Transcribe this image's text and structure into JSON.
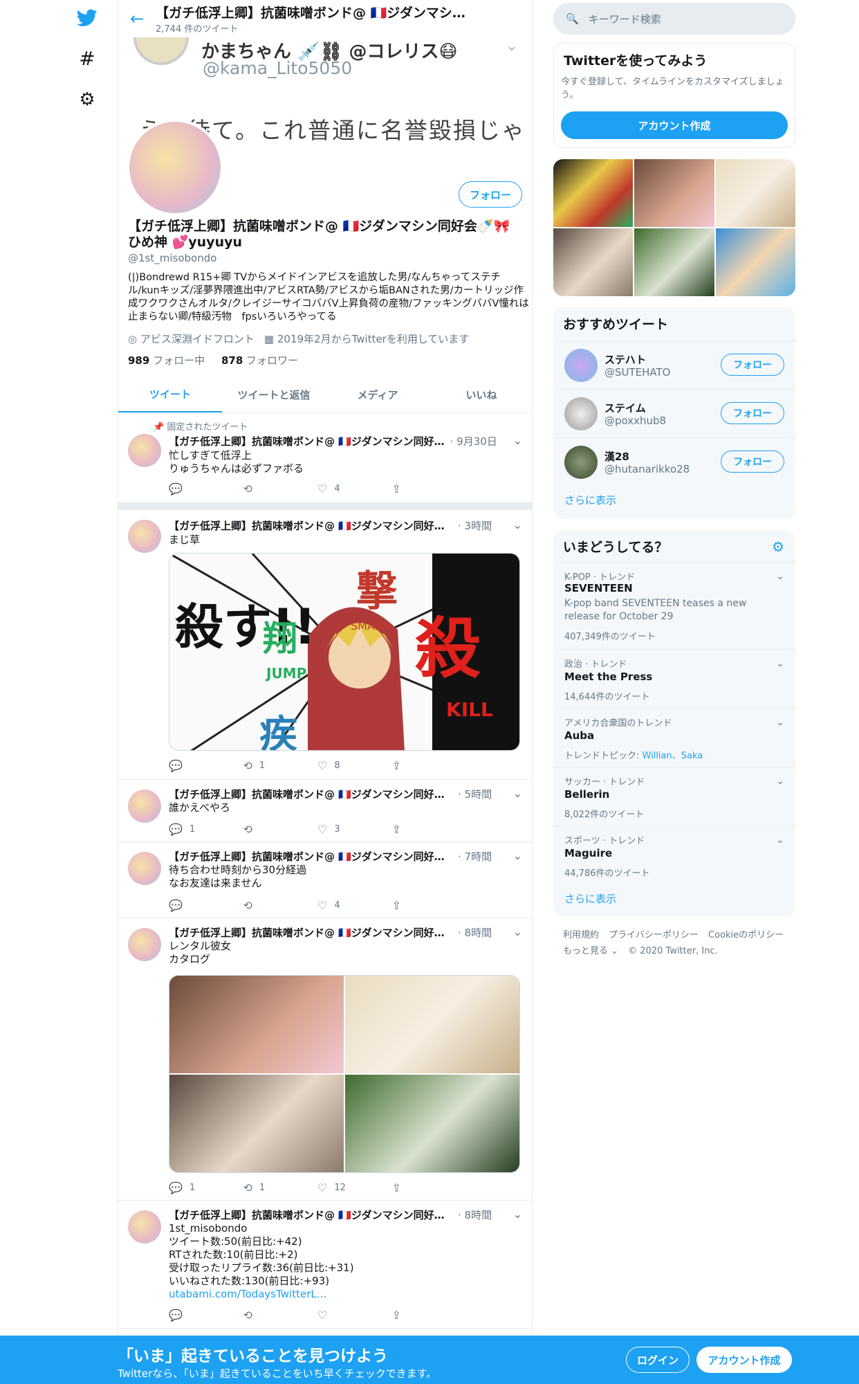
{
  "nav": {
    "icons": [
      "twitter-bird-icon",
      "hashtag-icon",
      "gear-icon"
    ]
  },
  "header": {
    "title": "【ガチ低浮上卿】抗菌味噌ボンド@ 🇫🇷ジダンマシ…",
    "tweet_count": "2,744 件のツイート"
  },
  "banner": {
    "name": "かまちゃん 💉⛓ @コレリス😷",
    "handle": "@kama_Lito5050",
    "text": "え、待て。これ普通に名誉毀損じゃ"
  },
  "profile": {
    "follow_label": "フォロー",
    "name": "【ガチ低浮上卿】抗菌味噌ボンド@ 🇫🇷ジダンマシン同好会🍼🎀ひめ神 💕yuyuyu",
    "handle": "@1st_misobondo",
    "bio": "(|)Bondrewd R15+卿 TVからメイドインアビスを追放した男/なんちゃってステチル/kunキッズ/淫夢界隈進出中/アビスRTA勢/アビスから垢BANされた男/カートリッジ作成ワクワクさんオルタ/クレイジーサイコババV上昇負荷の産物/ファッキングババV憧れは止まらない卿/特級汚物　fpsいろいろやってる",
    "location": "アビス深淵イドフロント",
    "joined": "2019年2月からTwitterを利用しています",
    "following_count": "989",
    "following_label": "フォロー中",
    "followers_count": "878",
    "followers_label": "フォロワー"
  },
  "tabs": [
    "ツイート",
    "ツイートと返信",
    "メディア",
    "いいね"
  ],
  "pinned_label": "固定されたツイート",
  "tweets": [
    {
      "name": "【ガチ低浮上卿】抗菌味噌ボンド@ 🇫🇷ジダンマシン同好…",
      "time": "· 9月30日",
      "text": "忙しすぎて低浮上\nりゅうちゃんは必ずファボる",
      "replies": "",
      "retweets": "",
      "likes": "4"
    },
    {
      "name": "【ガチ低浮上卿】抗菌味噌ボンド@ 🇫🇷ジダンマシン同好会…",
      "time": "· 3時間",
      "text": "まじ草",
      "replies": "",
      "retweets": "1",
      "likes": "8"
    },
    {
      "name": "【ガチ低浮上卿】抗菌味噌ボンド@ 🇫🇷ジダンマシン同好会…",
      "time": "· 5時間",
      "text": "誰かえべやろ",
      "replies": "1",
      "retweets": "",
      "likes": "3"
    },
    {
      "name": "【ガチ低浮上卿】抗菌味噌ボンド@ 🇫🇷ジダンマシン同好会…",
      "time": "· 7時間",
      "text": "待ち合わせ時刻から30分経過\nなお友達は来ません",
      "replies": "",
      "retweets": "",
      "likes": "4"
    },
    {
      "name": "【ガチ低浮上卿】抗菌味噌ボンド@ 🇫🇷ジダンマシン同好会…",
      "time": "· 8時間",
      "text": "レンタル彼女\nカタログ",
      "replies": "1",
      "retweets": "1",
      "likes": "12"
    },
    {
      "name": "【ガチ低浮上卿】抗菌味噌ボンド@ 🇫🇷ジダンマシン同好会…",
      "time": "· 8時間",
      "text": "1st_misobondo\nツイート数:50(前日比:+42)\nRTされた数:10(前日比:+2)\n受け取ったリプライ数:36(前日比:+31)\nいいねされた数:130(前日比:+93)",
      "link": "utabami.com/TodaysTwitterL…",
      "replies": "",
      "retweets": "",
      "likes": ""
    }
  ],
  "manga": {
    "kill": "殺す!!",
    "smash": "SMASH",
    "jump": "JUMP",
    "killen": "KILL",
    "k1": "撃",
    "k2": "翔",
    "k3": "殺",
    "k4": "疾"
  },
  "right": {
    "search_placeholder": "キーワード検索",
    "signup_title": "Twitterを使ってみよう",
    "signup_text": "今すぐ登録して、タイムラインをカスタマイズしましょう。",
    "signup_button": "アカウント作成",
    "rec_title": "おすすめツイート",
    "recs": [
      {
        "name": "ステハト",
        "handle": "@SUTEHATO",
        "button": "フォロー"
      },
      {
        "name": "ステイム",
        "handle": "@poxxhub8",
        "button": "フォロー"
      },
      {
        "name": "漢28",
        "handle": "@hutanarikko28",
        "button": "フォロー"
      }
    ],
    "show_more": "さらに表示",
    "trends_title": "いまどうしてる？",
    "trends": [
      {
        "category": "K-POP · トレンド",
        "name": "SEVENTEEN",
        "desc": "K-pop band SEVENTEEN teases a new release for October 29",
        "count": "407,349件のツイート"
      },
      {
        "category": "政治 · トレンド",
        "name": "Meet the Press",
        "count": "14,644件のツイート"
      },
      {
        "category": "アメリカ合衆国のトレンド",
        "name": "Auba",
        "topic_label": "トレンドトピック:",
        "topics": "Willian、Saka"
      },
      {
        "category": "サッカー · トレンド",
        "name": "Bellerin",
        "count": "8,022件のツイート"
      },
      {
        "category": "スポーツ · トレンド",
        "name": "Maguire",
        "count": "44,786件のツイート"
      }
    ],
    "footer": [
      "利用規約",
      "プライバシーポリシー",
      "Cookieのポリシー",
      "もっと見る ⌄",
      "© 2020 Twitter, Inc."
    ]
  },
  "bottombar": {
    "title": "「いま」起きていることを見つけよう",
    "subtitle": "Twitterなら、「いま」起きていることをいち早くチェックできます。",
    "login": "ログイン",
    "signup": "アカウント作成"
  },
  "colors": {
    "accent": "#1da1f2",
    "text": "#14171a",
    "secondary": "#657786"
  }
}
